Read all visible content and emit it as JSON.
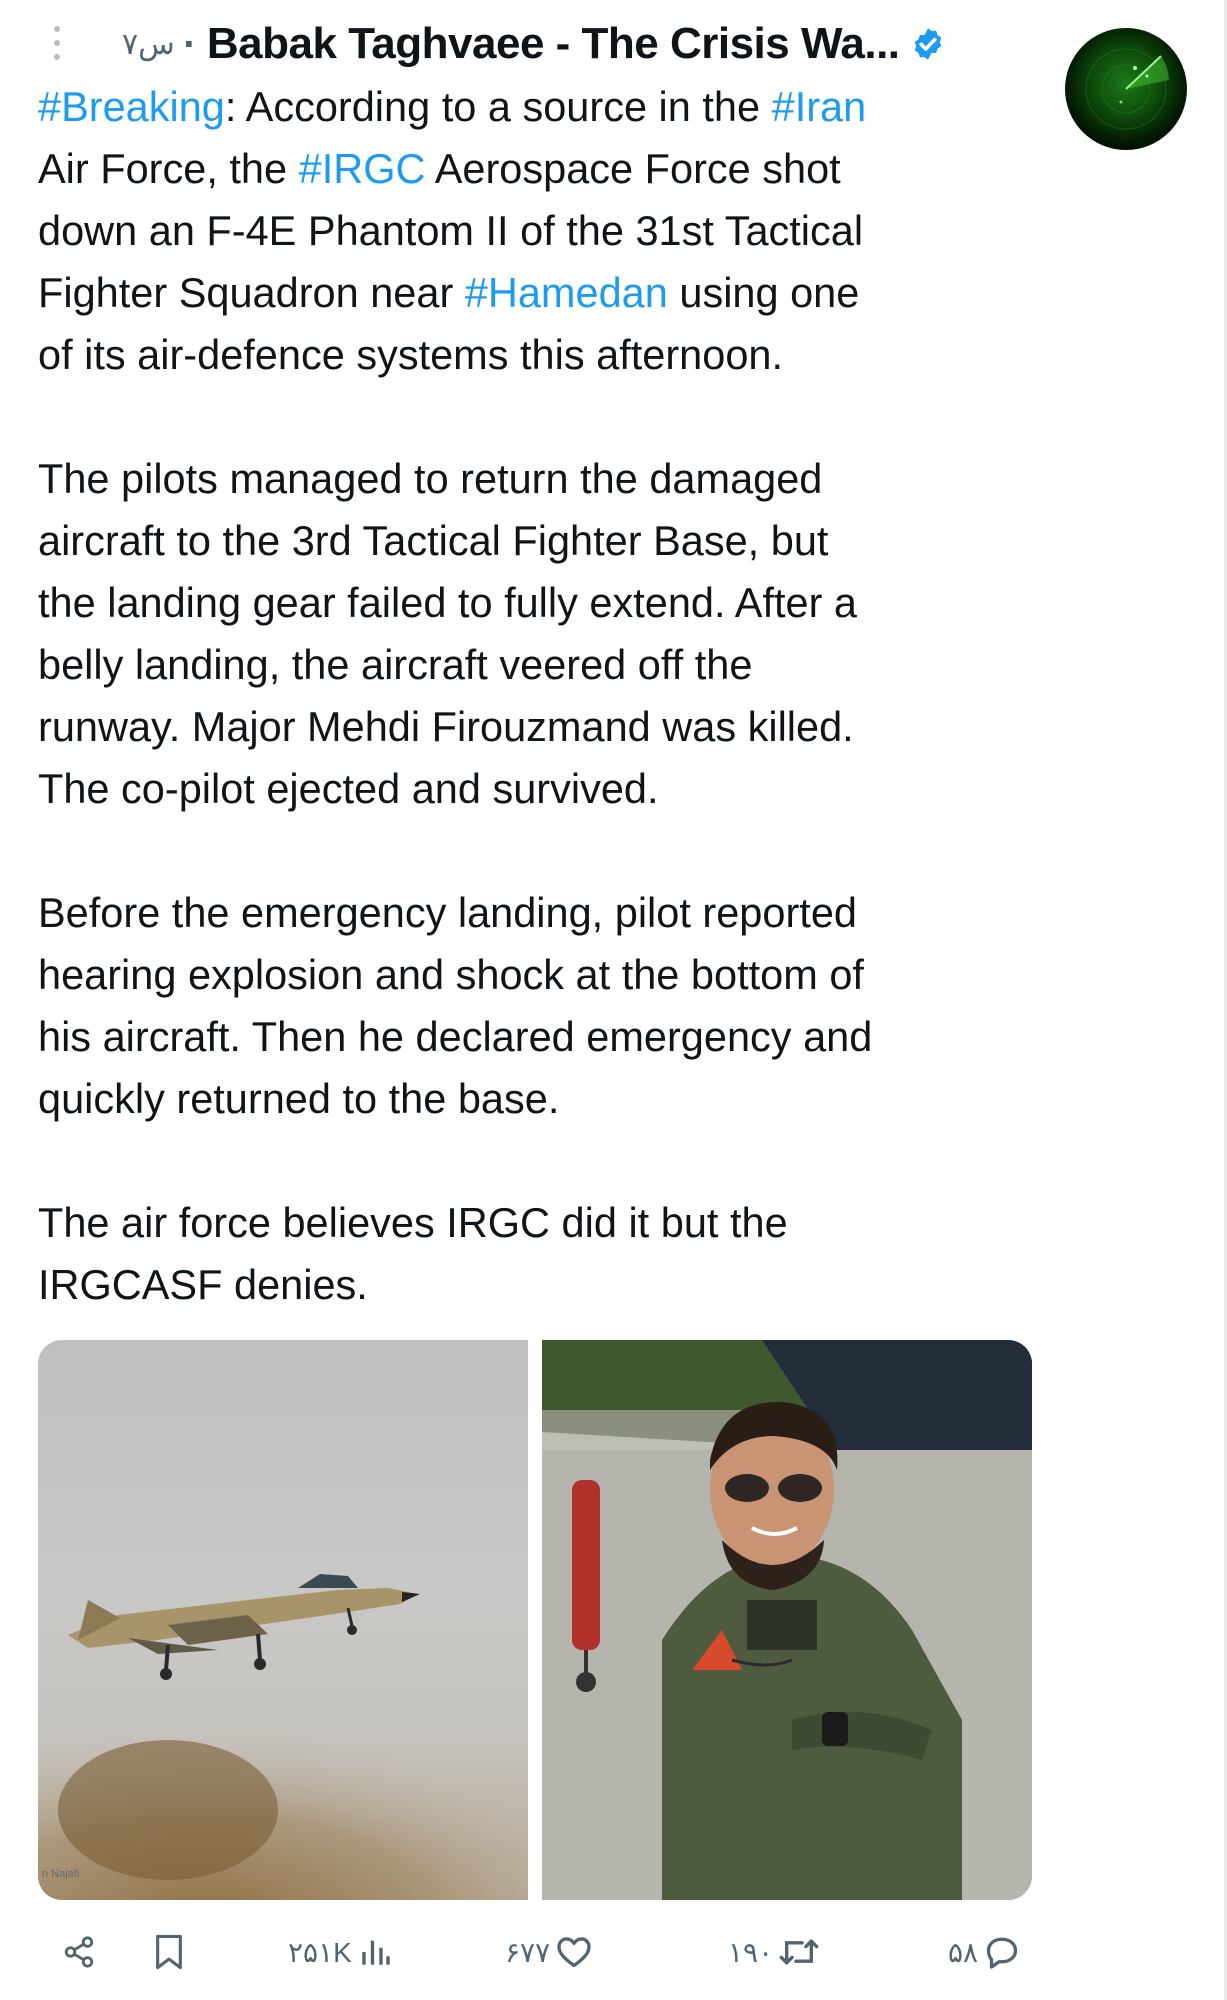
{
  "header": {
    "timestamp": "۷س",
    "separator": "·",
    "author_name": "Babak Taghvaee - The Crisis Wa...",
    "verified": true
  },
  "tweet": {
    "paragraphs": [
      {
        "lines": [
          [
            {
              "text": "#Breaking",
              "tag": true
            },
            {
              "text": ": According to a source in the ",
              "tag": false
            },
            {
              "text": "#Iran",
              "tag": true
            }
          ],
          [
            {
              "text": "Air Force, the ",
              "tag": false
            },
            {
              "text": "#IRGC",
              "tag": true
            },
            {
              "text": " Aerospace Force shot",
              "tag": false
            }
          ],
          [
            {
              "text": "down an F-4E Phantom II of the 31st Tactical",
              "tag": false
            }
          ],
          [
            {
              "text": "Fighter Squadron near ",
              "tag": false
            },
            {
              "text": "#Hamedan",
              "tag": true
            },
            {
              "text": " using one",
              "tag": false
            }
          ],
          [
            {
              "text": "of its air-defence systems this afternoon.",
              "tag": false
            }
          ]
        ]
      },
      {
        "lines": [
          [
            {
              "text": "The pilots managed to return the damaged",
              "tag": false
            }
          ],
          [
            {
              "text": "aircraft to the 3rd Tactical Fighter Base, but",
              "tag": false
            }
          ],
          [
            {
              "text": "the landing gear failed to fully extend. After a",
              "tag": false
            }
          ],
          [
            {
              "text": "belly landing, the aircraft veered off the",
              "tag": false
            }
          ],
          [
            {
              "text": "runway. Major Mehdi Firouzmand was killed.",
              "tag": false
            }
          ],
          [
            {
              "text": "The co-pilot ejected and survived.",
              "tag": false
            }
          ]
        ]
      },
      {
        "lines": [
          [
            {
              "text": "Before the emergency landing, pilot reported",
              "tag": false
            }
          ],
          [
            {
              "text": "hearing explosion and shock at the bottom of",
              "tag": false
            }
          ],
          [
            {
              "text": "his aircraft. Then he declared emergency and",
              "tag": false
            }
          ],
          [
            {
              "text": "quickly returned to the base.",
              "tag": false
            }
          ]
        ]
      },
      {
        "lines": [
          [
            {
              "text": "The air force believes IRGC did it but the",
              "tag": false
            }
          ],
          [
            {
              "text": "IRGCASF denies.",
              "tag": false
            }
          ]
        ]
      }
    ]
  },
  "media": {
    "photo_credit": "n Najafi"
  },
  "actions": {
    "share_icon": "share-icon",
    "bookmark_icon": "bookmark-icon",
    "views_icon": "bar-chart-icon",
    "views": "۲۵۱K",
    "likes_icon": "heart-icon",
    "likes": "۶۷۷",
    "retweets_icon": "retweet-icon",
    "retweets": "۱۹۰",
    "replies_icon": "reply-icon",
    "replies": "۵۸"
  },
  "colors": {
    "text": "#0f1419",
    "secondary": "#536471",
    "link": "#1d9bf0",
    "verified": "#1d9bf0"
  }
}
